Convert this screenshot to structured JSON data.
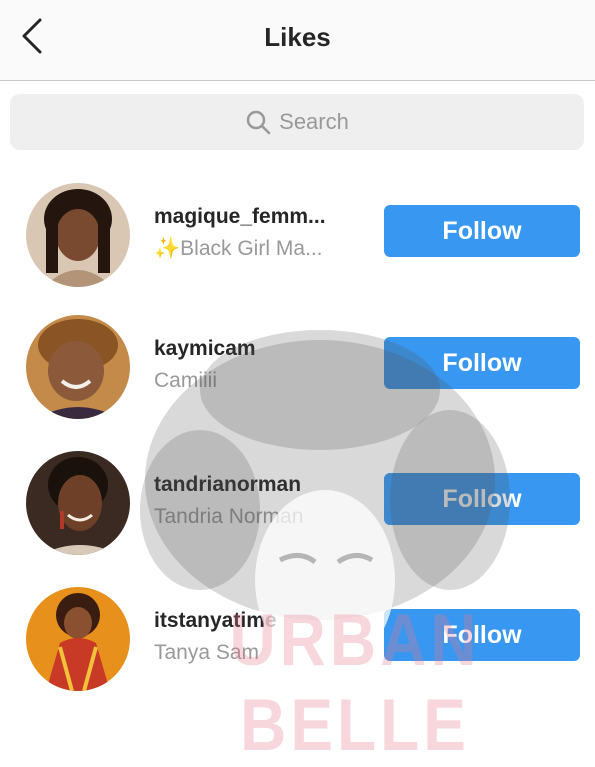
{
  "header": {
    "title": "Likes",
    "back_icon": "chevron-left-icon"
  },
  "search": {
    "placeholder": "Search",
    "icon": "search-icon"
  },
  "users": [
    {
      "username": "magique_femm...",
      "fullname": "✨Black Girl Ma...",
      "follow_label": "Follow",
      "avatar_colors": [
        "#3a2418",
        "#c79a72"
      ]
    },
    {
      "username": "kaymicam",
      "fullname": "Camiiii",
      "follow_label": "Follow",
      "avatar_colors": [
        "#7a4b26",
        "#d9a25b"
      ]
    },
    {
      "username": "tandrianorman",
      "fullname": "Tandria Norman",
      "follow_label": "Follow",
      "avatar_colors": [
        "#2b1a12",
        "#8a5a3a"
      ]
    },
    {
      "username": "itstanyatime",
      "fullname": "Tanya Sam",
      "follow_label": "Follow",
      "avatar_colors": [
        "#e07a1c",
        "#c23a2a"
      ]
    }
  ],
  "watermark": {
    "text": "URBAN BELLE"
  },
  "colors": {
    "follow_button": "#3897f0",
    "secondary_text": "#999999",
    "primary_text": "#262626"
  }
}
